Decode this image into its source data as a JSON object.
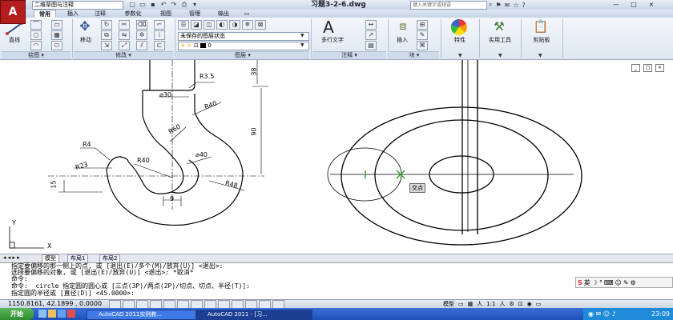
{
  "titlebar": {
    "workspace": "二维草图与注释",
    "document_title": "习题3-2-6.dwg",
    "search_placeholder": "键入关键字或短语",
    "window_buttons": [
      "—",
      "□",
      "×"
    ]
  },
  "menu_tabs": [
    "常用",
    "插入",
    "注释",
    "参数化",
    "视图",
    "管理",
    "输出",
    "▭"
  ],
  "ribbon": {
    "draw": {
      "line_label": "直线",
      "panel_label": "绘图 ▾"
    },
    "modify": {
      "move_label": "移动",
      "panel_label": "修改 ▾"
    },
    "layers": {
      "layer_state": "未保存的图层状态",
      "layer_current": "0",
      "panel_label": "图层 ▾"
    },
    "annotation": {
      "mtext_label": "多行文字",
      "panel_label": "注释 ▾"
    },
    "block": {
      "insert_label": "插入",
      "panel_label": "块 ▾"
    },
    "properties": {
      "label": "特性"
    },
    "utilities": {
      "label": "实用工具"
    },
    "clipboard": {
      "label": "剪贴板"
    }
  },
  "drawing": {
    "dims": {
      "r35": "R3.5",
      "d30": "⌀30",
      "r40a": "R40",
      "r60": "R60",
      "d40": "⌀40",
      "r4": "R4",
      "r23": "R23",
      "r40b": "R40",
      "r48": "R48",
      "n15": "15",
      "n9": "9",
      "n38": "38",
      "n90": "90"
    },
    "ucs_x": "X",
    "ucs_y": "Y",
    "snap_tooltip": "交点"
  },
  "layout_tabs": [
    "模型",
    "布局1",
    "布局2"
  ],
  "command_lines": [
    "指定要偏移的那一侧上的点, 或 [退出(E)/多个(M)/放弃(U)] <退出>:",
    "选择要偏移的对象, 或 [退出(E)/放弃(U)] <退出>: *取消*",
    "命令:",
    "命令: _circle 指定圆的圆心或 [三点(3P)/两点(2P)/切点、切点、半径(T)]:",
    "指定圆的半径或 [直径(D)] <45.0000>:"
  ],
  "ime": {
    "label": "英"
  },
  "statusbar": {
    "coords": "1150.8161, 42.1899 , 0.0000",
    "model_label": "模型",
    "scale": "1:1",
    "ime_label": "英"
  },
  "taskbar": {
    "start": "开始",
    "tasks": [
      "AutoCAD 2011实例教...",
      "AutoCAD 2011 - [习..."
    ],
    "clock": "23:09"
  },
  "colors": {
    "title_bg": "#c9d5e6",
    "taskbar": "#1d4fb8",
    "logo": "#b31d1d",
    "snap_marker": "#2aa52a"
  }
}
